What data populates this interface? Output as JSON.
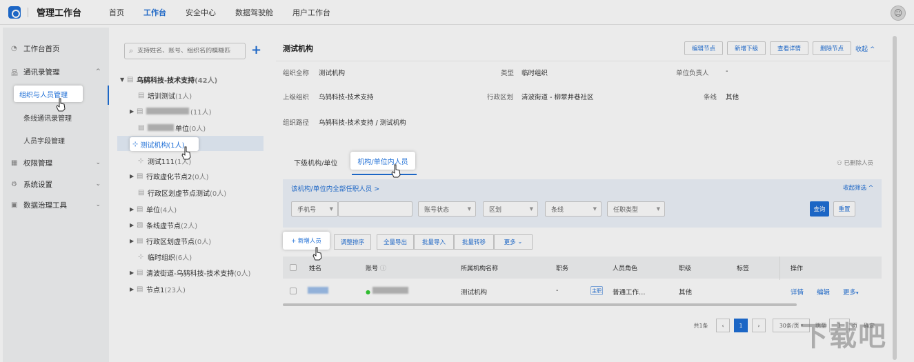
{
  "topbar": {
    "brand": "管理工作台",
    "nav": [
      "首页",
      "工作台",
      "安全中心",
      "数据驾驶舱",
      "用户工作台"
    ],
    "active_nav": "工作台"
  },
  "sidebar": {
    "items": [
      {
        "label": "工作台首页",
        "icon": "dashboard-icon"
      },
      {
        "label": "通讯录管理",
        "icon": "org-icon",
        "expanded": true
      },
      {
        "label": "组织与人员管理",
        "sub": true,
        "active": true
      },
      {
        "label": "条线通讯录管理",
        "sub": true
      },
      {
        "label": "人员字段管理",
        "sub": true
      },
      {
        "label": "权限管理",
        "icon": "grid-icon"
      },
      {
        "label": "系统设置",
        "icon": "gear-icon"
      },
      {
        "label": "数据治理工具",
        "icon": "data-icon"
      }
    ]
  },
  "tree": {
    "search_placeholder": "支持姓名、账号、组织名的模糊匹",
    "add_label": "+",
    "nodes": [
      {
        "label": "乌鸫科技-技术支持",
        "count": "(42人)"
      },
      {
        "label": "培训测试",
        "count": "(1人)"
      },
      {
        "label": "",
        "count": "(11人)"
      },
      {
        "label": "单位",
        "count": "(0人)"
      },
      {
        "label": "测试机构",
        "count": "(1人)"
      },
      {
        "label": "测试111",
        "count": "(1人)"
      },
      {
        "label": "行政虚化节点2",
        "count": "(0人)"
      },
      {
        "label": "行政区划虚节点测试",
        "count": "(0人)"
      },
      {
        "label": "单位",
        "count": "(4人)"
      },
      {
        "label": "条线虚节点",
        "count": "(2人)"
      },
      {
        "label": "行政区划虚节点",
        "count": "(0人)"
      },
      {
        "label": "临时组织",
        "count": "(6人)"
      },
      {
        "label": "清波街道-乌鸫科技-技术支持",
        "count": "(0人)"
      },
      {
        "label": "节点1",
        "count": "(23人)"
      }
    ]
  },
  "detail": {
    "title": "测试机构",
    "buttons": [
      "编辑节点",
      "新增下级",
      "查看详情",
      "删除节点"
    ],
    "collapse": "收起 ^",
    "fields": {
      "full_name_label": "组织全称",
      "full_name": "测试机构",
      "type_label": "类型",
      "type": "临时组织",
      "leader_label": "单位负责人",
      "leader": "-",
      "parent_label": "上级组织",
      "parent": "乌鸫科技-技术支持",
      "region_label": "行政区划",
      "region": "清波街道 - 柳翠井巷社区",
      "line_label": "条线",
      "line": "其他",
      "path_label": "组织路径",
      "path": "乌鸫科技-技术支持 / 测试机构"
    }
  },
  "lower": {
    "tabs": [
      "下级机构/单位",
      "机构/单位内人员"
    ],
    "deleted_people": "已删除人员",
    "filter": {
      "title": "该机构/单位内全部任职人员 >",
      "collapse": "收起筛选 ^",
      "selects": [
        "手机号",
        "",
        "账号状态",
        "区划",
        "条线",
        "任职类型"
      ],
      "query": "查询",
      "reset": "重置"
    },
    "actions": [
      "+ 新增人员",
      "调整排序",
      "全量导出",
      "批量导入",
      "批量转移",
      "更多"
    ],
    "table": {
      "headers": [
        "姓名",
        "账号",
        "所属机构名称",
        "职务",
        "人员角色",
        "职级",
        "标签",
        "操作"
      ],
      "row": {
        "org": "测试机构",
        "position": "-",
        "tag_main": "主职",
        "role": "普通工作…",
        "rank": "其他",
        "ops": [
          "详情",
          "编辑",
          "更多"
        ]
      }
    },
    "pager": {
      "total": "共1条",
      "current": "1",
      "page_size": "30条/页",
      "goto_label": "跳至",
      "goto_value": "1",
      "page_unit": "页",
      "ok": "确定"
    }
  },
  "watermark": "下载吧",
  "colors": {
    "accent": "#1f6fd6"
  }
}
